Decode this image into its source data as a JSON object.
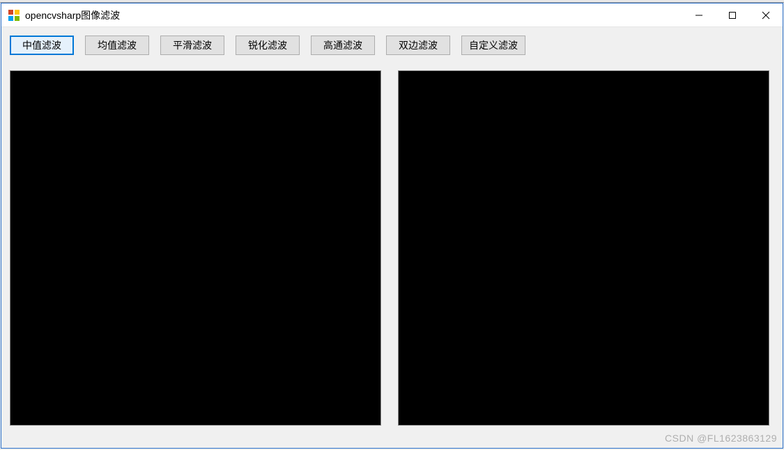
{
  "window": {
    "title": "opencvsharp图像滤波"
  },
  "toolbar": {
    "buttons": [
      {
        "label": "中值滤波",
        "active": true
      },
      {
        "label": "均值滤波",
        "active": false
      },
      {
        "label": "平滑滤波",
        "active": false
      },
      {
        "label": "锐化滤波",
        "active": false
      },
      {
        "label": "高通滤波",
        "active": false
      },
      {
        "label": "双边滤波",
        "active": false
      },
      {
        "label": "自定义滤波",
        "active": false
      }
    ]
  },
  "watermark": "CSDN @FL1623863129"
}
